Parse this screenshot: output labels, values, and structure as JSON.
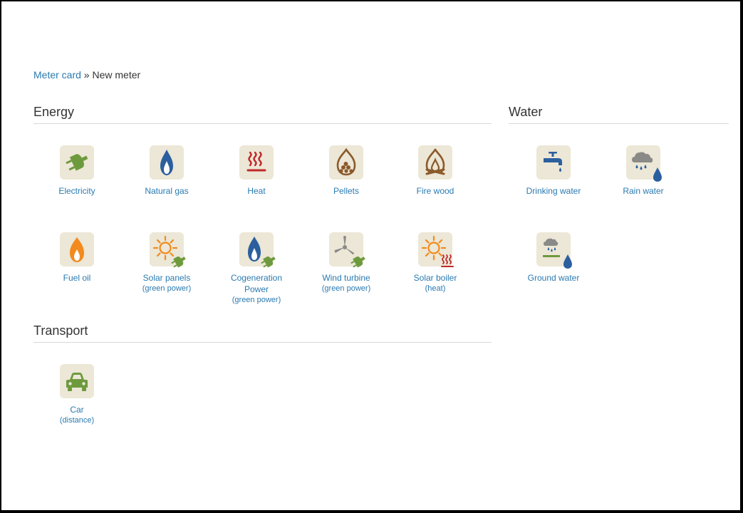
{
  "breadcrumb": {
    "parent": "Meter card",
    "separator": " » ",
    "current": "New meter"
  },
  "sections": {
    "energy": {
      "title": "Energy"
    },
    "water": {
      "title": "Water"
    },
    "transport": {
      "title": "Transport"
    }
  },
  "meters": {
    "electricity": {
      "label": "Electricity",
      "icon": "plug-icon"
    },
    "natural_gas": {
      "label": "Natural gas",
      "icon": "gas-flame-icon"
    },
    "heat": {
      "label": "Heat",
      "icon": "heat-icon"
    },
    "pellets": {
      "label": "Pellets",
      "icon": "pellets-icon"
    },
    "fire_wood": {
      "label": "Fire wood",
      "icon": "firewood-icon"
    },
    "fuel_oil": {
      "label": "Fuel oil",
      "icon": "oil-flame-icon"
    },
    "solar_panels": {
      "label": "Solar panels",
      "sub": "(green power)",
      "icon": "solar-panel-icon"
    },
    "cogeneration": {
      "label": "Cogeneration",
      "label2": "Power",
      "sub": "(green power)",
      "icon": "cogeneration-icon"
    },
    "wind_turbine": {
      "label": "Wind turbine",
      "sub": "(green power)",
      "icon": "wind-turbine-icon"
    },
    "solar_boiler": {
      "label": "Solar boiler",
      "sub": "(heat)",
      "icon": "solar-boiler-icon"
    },
    "drinking_water": {
      "label": "Drinking water",
      "icon": "tap-icon"
    },
    "rain_water": {
      "label": "Rain water",
      "icon": "rain-cloud-icon"
    },
    "ground_water": {
      "label": "Ground water",
      "icon": "ground-water-icon"
    },
    "car": {
      "label": "Car",
      "sub": "(distance)",
      "icon": "car-icon"
    }
  },
  "colors": {
    "link": "#2a7ab0",
    "tile_bg": "#ece7d6",
    "green": "#6e9a3e",
    "blue": "#2c5f9e",
    "red": "#c0282b",
    "brown": "#8b5a2b",
    "orange": "#f28a1e"
  }
}
